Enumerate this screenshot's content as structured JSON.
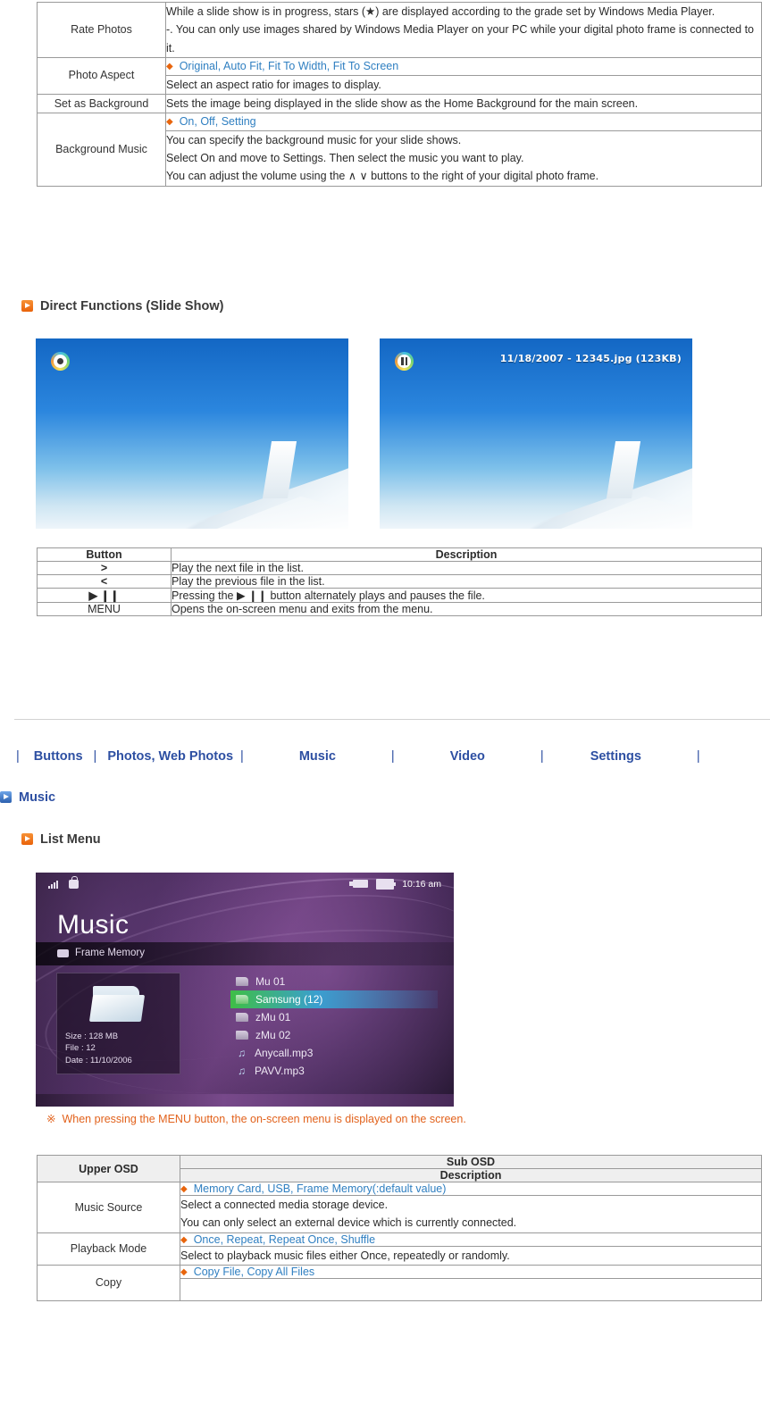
{
  "colors": {
    "accent_orange": "#e8650d",
    "link_blue": "#2f7fc1",
    "nav_blue": "#2d4fa2",
    "note_orange": "#e2621c",
    "table1_border": "#9a9a9a",
    "table2_border": "#d9c2e0",
    "table3_header_bg": "#efefef"
  },
  "slideshow_table": {
    "rows": [
      {
        "label": "Rate Photos",
        "type": "desc-only",
        "lines": [
          "While a slide show is in progress, stars (★) are displayed according to the grade set by Windows Media Player.",
          "-. You can only use images shared by Windows Media Player on your PC while your digital photo frame is connected to it."
        ]
      },
      {
        "label": "Photo Aspect",
        "type": "opt-desc",
        "options": "Original, Auto Fit, Fit To Width, Fit To Screen",
        "lines": [
          "Select an aspect ratio for images to display."
        ]
      },
      {
        "label": "Set as Background",
        "type": "desc-only",
        "lines": [
          "Sets the image being displayed in the slide show as the Home Background for the main screen."
        ]
      },
      {
        "label": "Background Music",
        "type": "opt-desc",
        "options": "On, Off, Setting",
        "lines": [
          "You can specify the background music for your slide shows.",
          "Select On and move to Settings. Then select the music you want to play.",
          "You can adjust the volume using the ∧ ∨ buttons to the right of your digital photo frame."
        ]
      }
    ]
  },
  "direct_functions": {
    "heading": "Direct Functions (Slide Show)",
    "photo_left": {
      "badge_icon": "record-icon"
    },
    "photo_right": {
      "badge_icon": "pause-icon",
      "filename_overlay": "11/18/2007 - 12345.jpg (123KB)"
    }
  },
  "button_table": {
    "headers": [
      "Button",
      "Description"
    ],
    "rows": [
      {
        "button": "&gt;",
        "description": "Play the next file in the list."
      },
      {
        "button": "&lt;",
        "description": "Play the previous file in the list."
      },
      {
        "button": "▶ ❙❙",
        "description": "Pressing the ▶ ❙❙ button alternately plays and pauses the file."
      },
      {
        "button": "MENU",
        "description": "Opens the on-screen menu and exits from the menu."
      }
    ]
  },
  "navbar": {
    "items": [
      "Buttons",
      "Photos, Web Photos",
      "Music",
      "Video",
      "Settings"
    ],
    "separator": "|"
  },
  "music_section": {
    "heading": "Music",
    "sub_heading": "List Menu",
    "note_mark": "※",
    "note_text": "When pressing the MENU button, the on-screen menu is displayed on the screen."
  },
  "device_screen": {
    "status": {
      "signal_icon": "signal-bars-icon",
      "lock_icon": "lock-icon",
      "usb_icon": "usb-icon",
      "battery_icon": "battery-icon",
      "time": "10:16 am"
    },
    "title": "Music",
    "source_label": "Frame Memory",
    "info_panel": {
      "folder_icon": "folder-icon",
      "size": "Size : 128 MB",
      "file": "File : 12",
      "date": "Date : 11/10/2006"
    },
    "file_list": [
      {
        "name": "Mu 01",
        "icon": "folder-icon",
        "selected": false
      },
      {
        "name": "Samsung (12)",
        "icon": "folder-icon",
        "selected": true
      },
      {
        "name": "zMu 01",
        "icon": "folder-icon",
        "selected": false
      },
      {
        "name": "zMu 02",
        "icon": "folder-icon",
        "selected": false
      },
      {
        "name": "Anycall.mp3",
        "icon": "music-note-icon",
        "selected": false
      },
      {
        "name": "PAVV.mp3",
        "icon": "music-note-icon",
        "selected": false
      }
    ]
  },
  "osd_table": {
    "header_left": "Upper OSD",
    "header_right_top": "Sub OSD",
    "header_right_bottom": "Description",
    "rows": [
      {
        "label": "Music Source",
        "options": "Memory Card, USB, Frame Memory(:default value)",
        "lines": [
          "Select a connected media storage device.",
          "You can only select an external device which is currently connected."
        ]
      },
      {
        "label": "Playback Mode",
        "options": "Once, Repeat, Repeat Once, Shuffle",
        "lines": [
          "Select to playback music files either Once, repeatedly or randomly."
        ]
      },
      {
        "label": "Copy",
        "options": "Copy File, Copy All Files",
        "lines": [
          ""
        ]
      }
    ]
  }
}
